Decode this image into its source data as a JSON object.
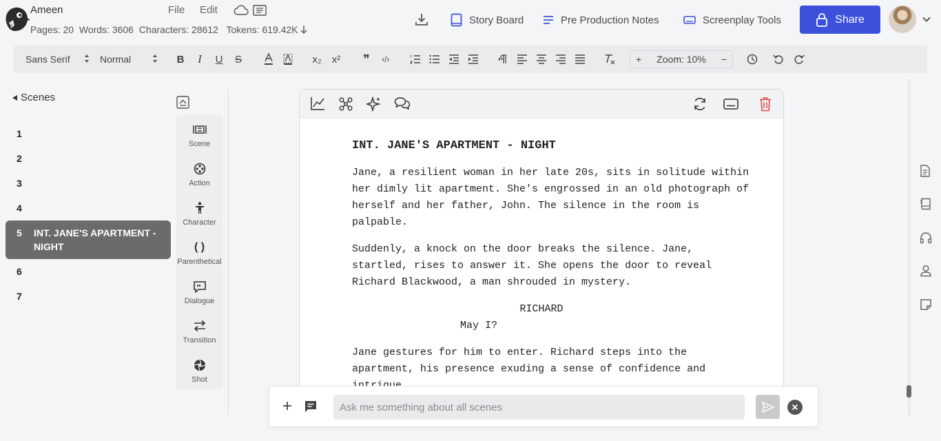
{
  "project": {
    "name": "Ameen"
  },
  "stats": {
    "text": "Pages: 20  Words: 3606  Characters: 28612   Tokens: 619.42K"
  },
  "menu": {
    "file": "File",
    "edit": "Edit"
  },
  "nav": {
    "story_board": "Story Board",
    "pre_production": "Pre Production Notes",
    "screenplay_tools": "Screenplay Tools",
    "share": "Share"
  },
  "toolbar": {
    "font": "Sans Serif",
    "size": "Normal",
    "bold": "B",
    "italic": "I",
    "underline": "U",
    "strike": "S",
    "sub": "x₂",
    "sup": "x²",
    "quote": "❞",
    "code": "‹/›",
    "zoom_plus": "+",
    "zoom_label": "Zoom: 10%",
    "zoom_minus": "−"
  },
  "scenes": {
    "title": "Scenes",
    "items": [
      {
        "num": "1",
        "label": ""
      },
      {
        "num": "2",
        "label": ""
      },
      {
        "num": "3",
        "label": ""
      },
      {
        "num": "4",
        "label": ""
      },
      {
        "num": "5",
        "label": "INT. JANE'S APARTMENT - NIGHT"
      },
      {
        "num": "6",
        "label": ""
      },
      {
        "num": "7",
        "label": ""
      }
    ],
    "active": "5"
  },
  "palette": {
    "scene": "Scene",
    "action": "Action",
    "character": "Character",
    "parenthetical": "Parenthetical",
    "parenthetical_glyph": "( )",
    "dialogue": "Dialogue",
    "transition": "Transition",
    "shot": "Shot"
  },
  "script": {
    "heading": "INT. JANE'S APARTMENT - NIGHT",
    "p1": "Jane, a resilient woman in her late 20s, sits in solitude within her dimly lit apartment. She's engrossed in an old photograph of herself and her father, John. The silence in the room is palpable.",
    "p2": "Suddenly, a knock on the door breaks the silence. Jane, startled, rises to answer it. She opens the door to reveal Richard Blackwood, a man shrouded in mystery.",
    "character": "RICHARD",
    "dialogue": "May I?",
    "p3": "Jane gestures for him to enter. Richard steps into the apartment, his presence exuding a sense of confidence and intrigue."
  },
  "chat": {
    "placeholder": "Ask me something about all scenes"
  },
  "colors": {
    "accent": "#3b51dc",
    "active_scene": "#6b6b6b",
    "delete": "#e04848"
  }
}
